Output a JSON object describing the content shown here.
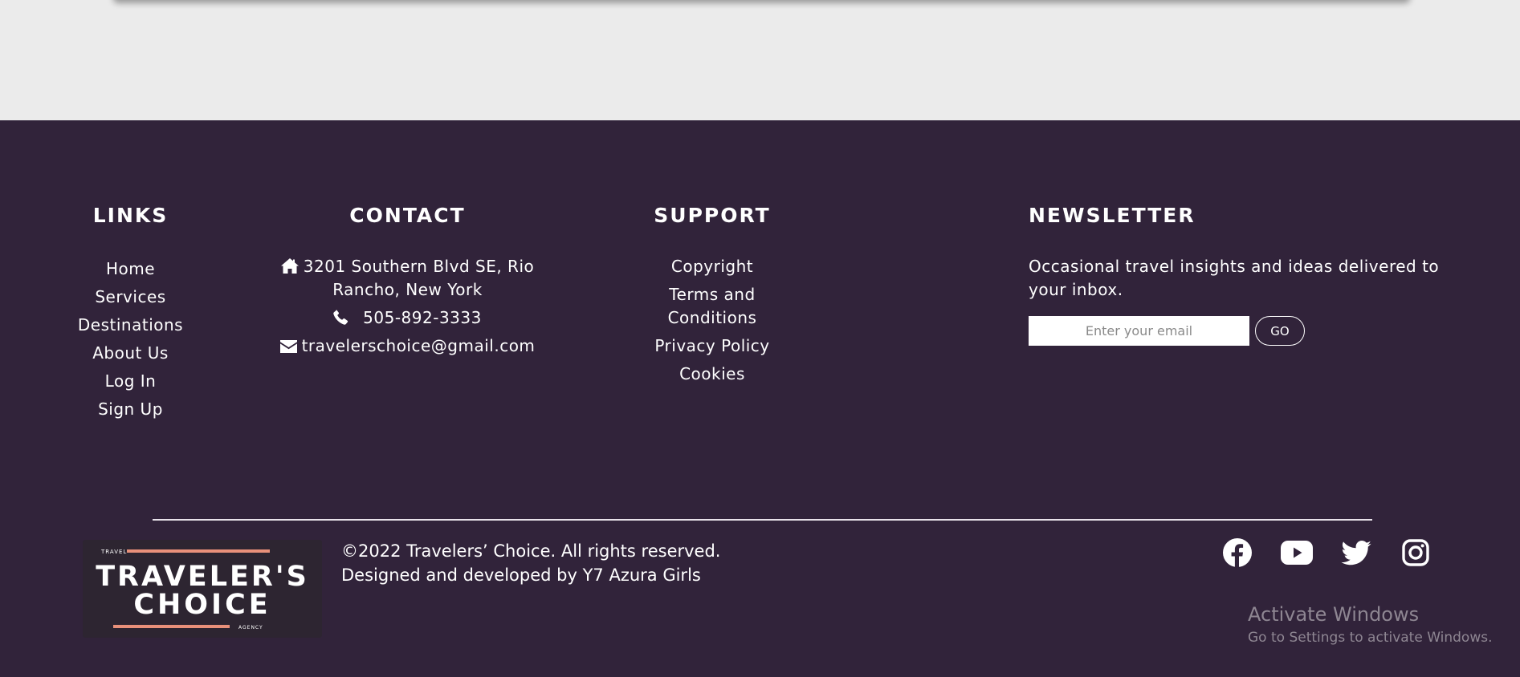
{
  "footer": {
    "links": {
      "title": "LINKS",
      "items": [
        "Home",
        "Services",
        "Destinations",
        "About Us",
        "Log In",
        "Sign Up"
      ]
    },
    "contact": {
      "title": "CONTACT",
      "address_line1": "3201 Southern Blvd SE, Rio",
      "address_line2": "Rancho, New York",
      "phone": "505-892-3333",
      "email": "travelerschoice@gmail.com",
      "icons": [
        "home-icon",
        "phone-icon",
        "envelope-icon"
      ]
    },
    "support": {
      "title": "SUPPORT",
      "items": [
        "Copyright",
        "Terms and Conditions",
        "Privacy Policy",
        "Cookies"
      ]
    },
    "newsletter": {
      "title": "NEWSLETTER",
      "description": "Occasional travel insights and ideas delivered to your inbox.",
      "input_placeholder": "Enter your email",
      "button_label": "GO"
    },
    "logo": {
      "small_top": "TRAVEL",
      "line1": "TRAVELER'S",
      "line2": "CHOICE",
      "small_bottom": "AGENCY",
      "accent_color": "#e8907a"
    },
    "copyright_line1": "©2022 Travelers’ Choice. All rights reserved.",
    "copyright_line2": "Designed and developed by Y7 Azura Girls",
    "socials": [
      "facebook-icon",
      "youtube-icon",
      "twitter-icon",
      "instagram-icon"
    ]
  },
  "watermark": {
    "title": "Activate Windows",
    "subtitle": "Go to Settings to activate Windows."
  },
  "colors": {
    "footer_bg": "#31233a",
    "page_bg": "#ebebeb",
    "text": "#ffffff"
  }
}
